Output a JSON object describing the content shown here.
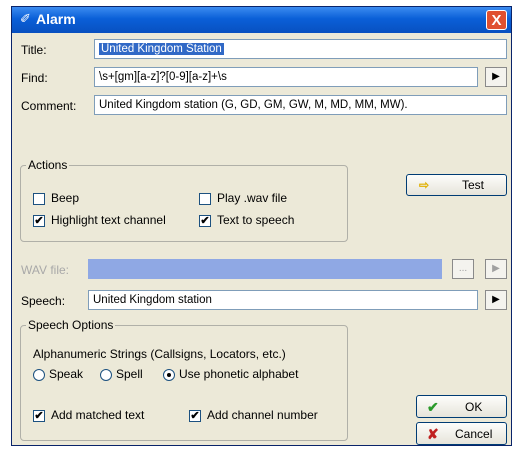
{
  "window": {
    "title": "Alarm",
    "close_label": "X"
  },
  "title_row": {
    "label": "Title:",
    "value": "United Kingdom Station"
  },
  "find_row": {
    "label": "Find:",
    "value": "\\s+[gm][a-z]?[0-9][a-z]+\\s",
    "button": "▶"
  },
  "comment_row": {
    "label": "Comment:",
    "value": "United Kingdom station (G, GD, GM, GW, M, MD, MM, MW)."
  },
  "actions": {
    "legend": "Actions",
    "beep": {
      "label": "Beep",
      "checked": false
    },
    "play_wav": {
      "label": "Play .wav file",
      "checked": false
    },
    "highlight": {
      "label": "Highlight text channel",
      "checked": true
    },
    "tts": {
      "label": "Text to speech",
      "checked": true
    }
  },
  "test_button": {
    "label": "Test"
  },
  "wav_row": {
    "label": "WAV file:",
    "value": "",
    "browse": "...",
    "play": "▶"
  },
  "speech_row": {
    "label": "Speech:",
    "value": "United Kingdom station",
    "play": "▶"
  },
  "speech_options": {
    "legend": "Speech Options",
    "caption": "Alphanumeric Strings (Callsigns, Locators, etc.)",
    "speak": "Speak",
    "spell": "Spell",
    "phonetic": "Use phonetic alphabet",
    "selected": "phonetic",
    "add_matched": {
      "label": "Add matched text",
      "checked": true
    },
    "add_channel": {
      "label": "Add channel number",
      "checked": true
    }
  },
  "ok_button": {
    "label": "OK"
  },
  "cancel_button": {
    "label": "Cancel"
  },
  "colors": {
    "titlebar": "#0a5fd8",
    "selection": "#3169c6",
    "wav_disabled": "#8fa8e4",
    "ok_icon": "#2a9a2a",
    "cancel_icon": "#c02020",
    "test_icon": "#e0b000"
  }
}
